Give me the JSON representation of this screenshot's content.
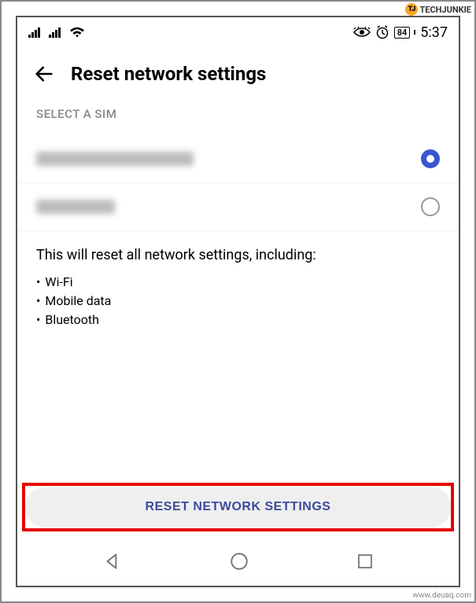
{
  "watermark_top": "TECHJUNKIE",
  "watermark_bottom": "www.deuaq.com",
  "status_bar": {
    "battery_text": "84",
    "time": "5:37"
  },
  "header": {
    "title": "Reset network settings"
  },
  "sim": {
    "section_label": "SELECT A SIM",
    "option1_selected": true,
    "option2_selected": false
  },
  "description": {
    "intro": "This will reset all network settings, including:",
    "items": [
      "Wi-Fi",
      "Mobile data",
      "Bluetooth"
    ]
  },
  "reset_button_label": "RESET NETWORK SETTINGS"
}
